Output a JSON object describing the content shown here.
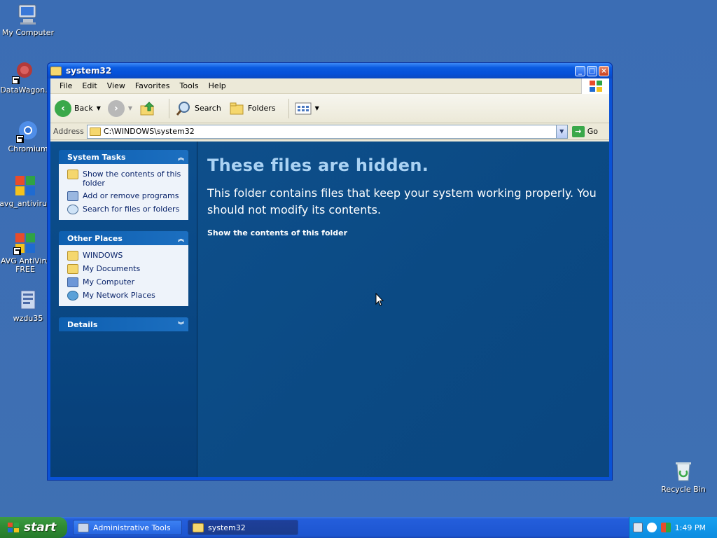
{
  "desktop": {
    "icons": [
      {
        "label": "My Computer"
      },
      {
        "label": "DataWagon."
      },
      {
        "label": "Chromium"
      },
      {
        "label": "avg_antivirus"
      },
      {
        "label": "AVG AntiViru FREE"
      },
      {
        "label": "wzdu35"
      },
      {
        "label": "Recycle Bin"
      }
    ]
  },
  "window": {
    "title": "system32",
    "menu": [
      "File",
      "Edit",
      "View",
      "Favorites",
      "Tools",
      "Help"
    ],
    "toolbar": {
      "back_label": "Back",
      "search_label": "Search",
      "folders_label": "Folders"
    },
    "address": {
      "label": "Address",
      "value": "C:\\WINDOWS\\system32",
      "go_label": "Go"
    },
    "taskpane": {
      "system_tasks": {
        "title": "System Tasks",
        "items": [
          {
            "label": "Show the contents of this folder"
          },
          {
            "label": "Add or remove programs"
          },
          {
            "label": "Search for files or folders"
          }
        ]
      },
      "other_places": {
        "title": "Other Places",
        "items": [
          {
            "label": "WINDOWS"
          },
          {
            "label": "My Documents"
          },
          {
            "label": "My Computer"
          },
          {
            "label": "My Network Places"
          }
        ]
      },
      "details": {
        "title": "Details"
      }
    },
    "main": {
      "title": "These files are hidden.",
      "description": "This folder contains files that keep your system working properly. You should not modify its contents.",
      "link": "Show the contents of this folder"
    }
  },
  "taskbar": {
    "start_label": "start",
    "tasks": [
      {
        "label": "Administrative Tools"
      },
      {
        "label": "system32"
      }
    ],
    "clock": "1:49 PM"
  },
  "colors": {
    "desktop": "#3b6db4",
    "task_pane": "#0c4f8e",
    "main_view": "#0b4a84",
    "hidden_title": "#aad2f3",
    "start_button": "#308d35"
  }
}
